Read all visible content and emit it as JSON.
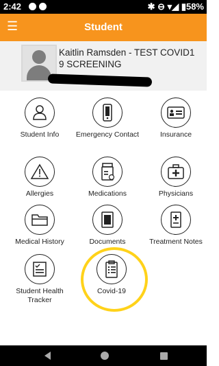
{
  "status_bar": {
    "time": "2:42",
    "right_text": "✱ ⊖ ▾◢ ▮58%"
  },
  "app_bar": {
    "title": "Student",
    "menu_icon": "☰"
  },
  "student": {
    "name_line1": "Kaitlin Ramsden - TEST COVID1",
    "name_line2": "9 SCREENING"
  },
  "grid": [
    {
      "label": "Student Info",
      "icon": "person-icon"
    },
    {
      "label": "Emergency Contact",
      "icon": "phone-icon"
    },
    {
      "label": "Insurance",
      "icon": "id-card-icon"
    },
    {
      "label": "Allergies",
      "icon": "warning-icon"
    },
    {
      "label": "Medications",
      "icon": "pill-bottle-icon"
    },
    {
      "label": "Physicians",
      "icon": "medical-kit-icon"
    },
    {
      "label": "Medical History",
      "icon": "folder-icon"
    },
    {
      "label": "Documents",
      "icon": "document-icon"
    },
    {
      "label": "Treatment Notes",
      "icon": "notes-plus-icon"
    },
    {
      "label": "Student Health Tracker",
      "icon": "checklist-icon"
    },
    {
      "label": "Covid-19",
      "icon": "clipboard-icon"
    }
  ],
  "colors": {
    "app_bar": "#f7941d",
    "highlight": "#ffd21a"
  }
}
